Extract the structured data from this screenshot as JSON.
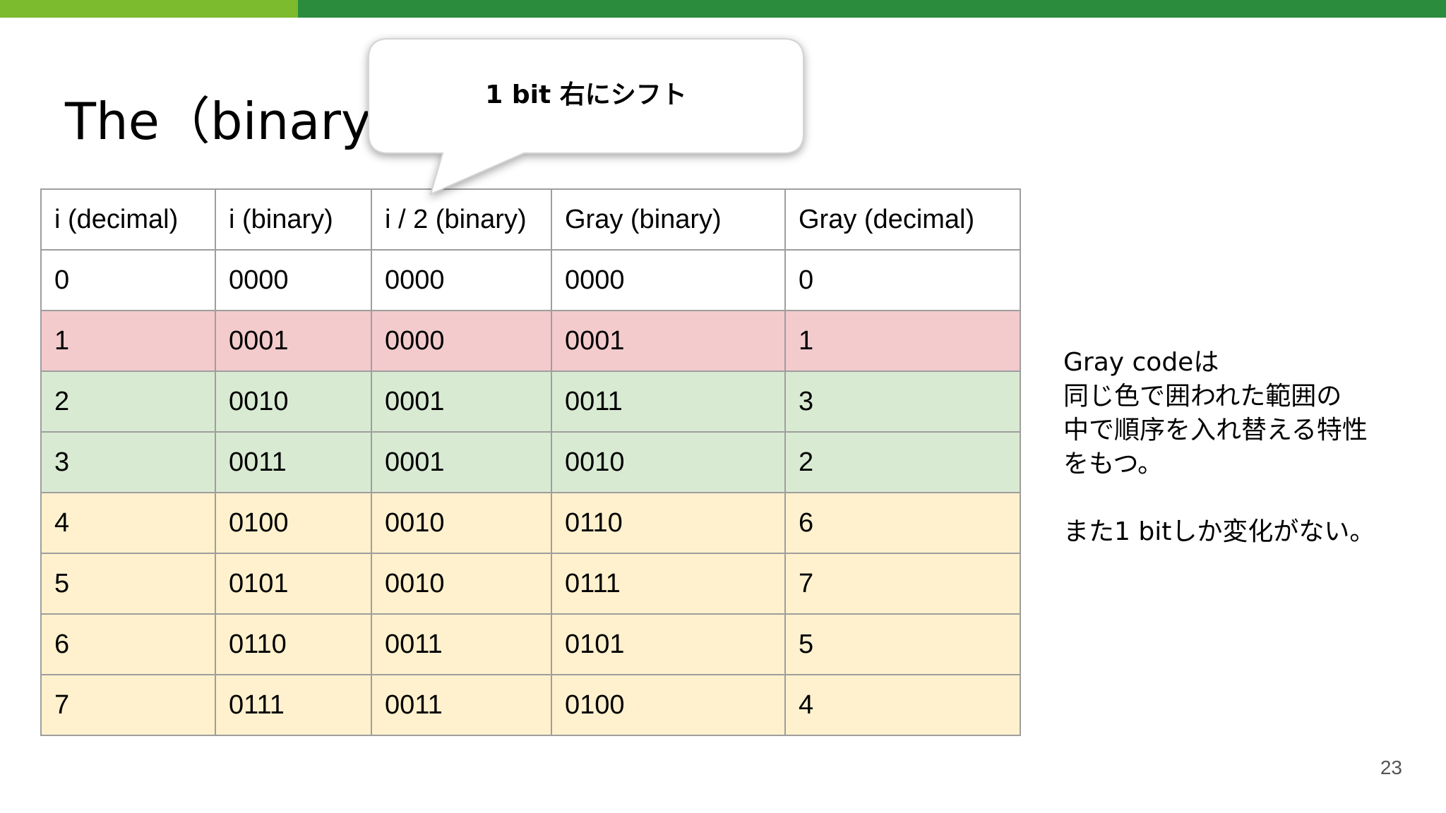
{
  "colors": {
    "bar_light": "#7cba2e",
    "bar_dark": "#2b8c3e",
    "row_red": "#f3cbcd",
    "row_green": "#d9ead3",
    "row_yellow": "#fff1cd",
    "row_white": "#ffffff",
    "border": "#9e9e9e"
  },
  "slide": {
    "title": "The（binary−> Gray）code",
    "callout": "1 bit 右にシフト",
    "page_number": "23"
  },
  "table": {
    "headers": [
      "i (decimal)",
      "i (binary)",
      "i / 2 (binary)",
      "Gray (binary)",
      "Gray (decimal)"
    ],
    "rows": [
      {
        "cells": [
          "0",
          "0000",
          "0000",
          "0000",
          "0"
        ],
        "color": "#ffffff"
      },
      {
        "cells": [
          "1",
          "0001",
          "0000",
          "0001",
          "1"
        ],
        "color": "#f3cbcd"
      },
      {
        "cells": [
          "2",
          "0010",
          "0001",
          "0011",
          "3"
        ],
        "color": "#d9ead3"
      },
      {
        "cells": [
          "3",
          "0011",
          "0001",
          "0010",
          "2"
        ],
        "color": "#d9ead3"
      },
      {
        "cells": [
          "4",
          "0100",
          "0010",
          "0110",
          "6"
        ],
        "color": "#fff1cd"
      },
      {
        "cells": [
          "5",
          "0101",
          "0010",
          "0111",
          "7"
        ],
        "color": "#fff1cd"
      },
      {
        "cells": [
          "6",
          "0110",
          "0011",
          "0101",
          "5"
        ],
        "color": "#fff1cd"
      },
      {
        "cells": [
          "7",
          "0111",
          "0011",
          "0100",
          "4"
        ],
        "color": "#fff1cd"
      }
    ]
  },
  "note": {
    "lines": [
      "Gray codeは",
      "同じ色で囲われた範囲の",
      "中で順序を入れ替える特性",
      "をもつ。"
    ],
    "extra": "また1 bitしか変化がない。"
  }
}
